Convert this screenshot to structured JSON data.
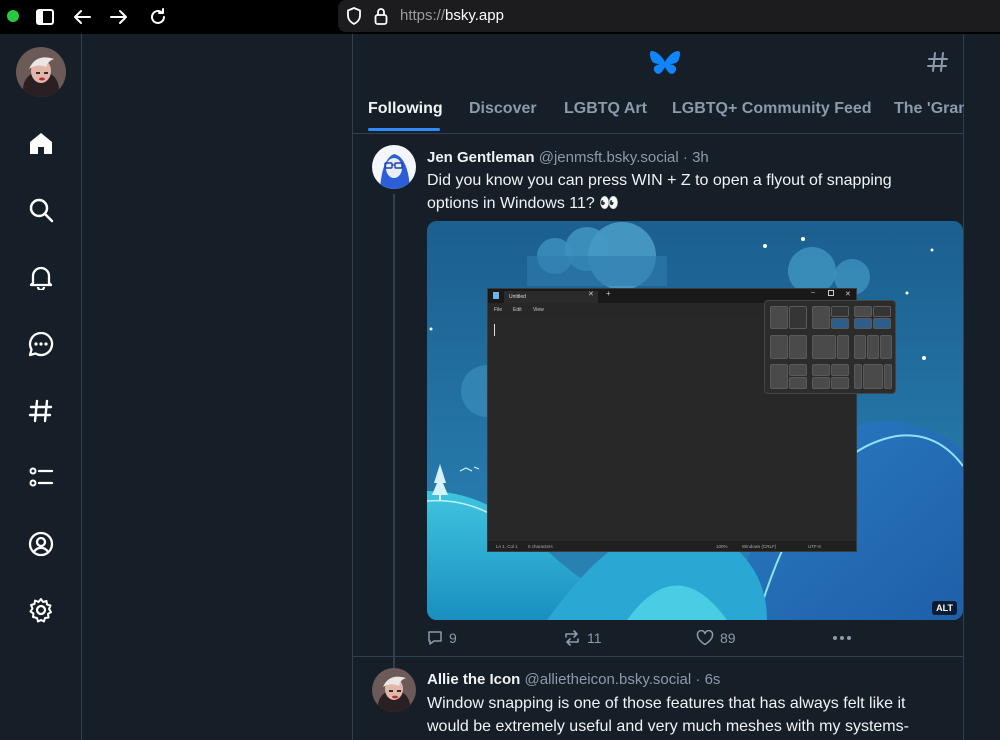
{
  "browser": {
    "url_scheme": "https://",
    "url_host": "bsky.app"
  },
  "nav": {
    "items": [
      "home-icon",
      "search-icon",
      "bell-icon",
      "chat-icon",
      "hashtag-icon",
      "list-icon",
      "profile-icon",
      "settings-icon"
    ]
  },
  "feed": {
    "tabs": [
      "Following",
      "Discover",
      "LGBTQ Art",
      "LGBTQ+ Community Feed",
      "The 'Gram"
    ],
    "active_tab": "Following"
  },
  "posts": [
    {
      "name": "Jen Gentleman",
      "handle": "@jenmsft.bsky.social",
      "sep": "·",
      "time": "3h",
      "text": "Did you know you can press WIN + Z to open a flyout of snapping options in Windows 11? 👀",
      "image_alt_badge": "ALT",
      "replies": "9",
      "reposts": "11",
      "likes": "89"
    },
    {
      "name": "Allie the Icon",
      "handle": "@allietheicon.bsky.social",
      "sep": "·",
      "time": "6s",
      "text": "Window snapping is one of those features that has always felt like it would be extremely useful and very much meshes with my systems-"
    }
  ],
  "notepad": {
    "tab_title": "Untitled",
    "menu": [
      "File",
      "Edit",
      "View"
    ],
    "status": [
      "Ln 1, Col 1",
      "0 characters",
      "100%",
      "Windows (CRLF)",
      "UTF-8"
    ]
  },
  "colors": {
    "background": "#161e27",
    "accent": "#2f8cff",
    "border": "#2e4052",
    "muted_text": "#8c9aad"
  }
}
